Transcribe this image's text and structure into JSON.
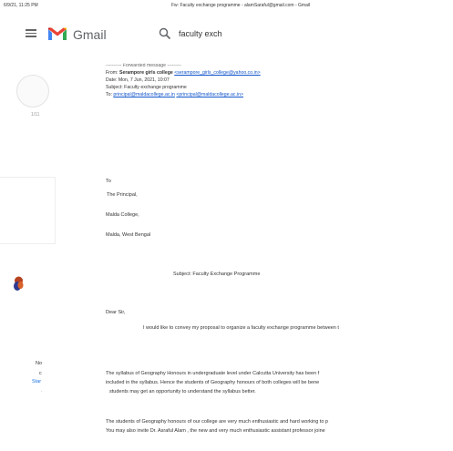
{
  "browser_header": {
    "timestamp": "6/9/21, 11:25 PM",
    "page_title": "Fw: Faculty exchange programme - alamSaraful@gmail.com - Gmail"
  },
  "gmail": {
    "product_name": "Gmail",
    "search_value": "faculty exch"
  },
  "sidebar": {
    "count": "1/11",
    "no_label": "No",
    "c_label": "c",
    "star_label": "Star",
    "dot_label": "·"
  },
  "message": {
    "forwarded": "---------- Forwarded message ---------",
    "from_label": "From:",
    "from_name": "Serampore girls college",
    "from_email": "<serampore_girls_college@yahoo.co.in>",
    "date_line": "Date: Mon, 7 Jun, 2021, 10:07",
    "subject_line": "Subject: Faculty exchange programme",
    "to_label": "To:",
    "to_email": "principal@maldacollege.ac.in",
    "to_email_2": "<principal@maldacollege.ac.in>",
    "addr_to": "To",
    "addr_1": "The Principal,",
    "addr_2": "Malda College,",
    "addr_3": "Malda, West Bengal",
    "subject_center": "Subject: Faculty Exchange Programme",
    "greeting": "Dear Sir,",
    "para1": "I would like to convey my proposal to organize a faculty exchange  programme  between t",
    "para2_l1": "The syllabus of Geography Honours in undergraduate level under Calcutta University has been f",
    "para2_l2": "included in the syllabus. Hence the students of Geography honours of both colleges will be bene",
    "para2_l3": "students may get an opportunity to understand the syllabus better.",
    "para3_l1": "The students of Geography honours of our college are very much enthusiastic and hard working to p",
    "para3_l2": "You may also invite Dr. Asraful Alam , the new and very much enthusiastic assistant professor  joine"
  },
  "colors": {
    "gmail_red": "#ea4335",
    "gmail_blue": "#4285f4",
    "gmail_green": "#34a853",
    "gmail_yellow": "#fbbc04",
    "link": "#1155cc"
  }
}
